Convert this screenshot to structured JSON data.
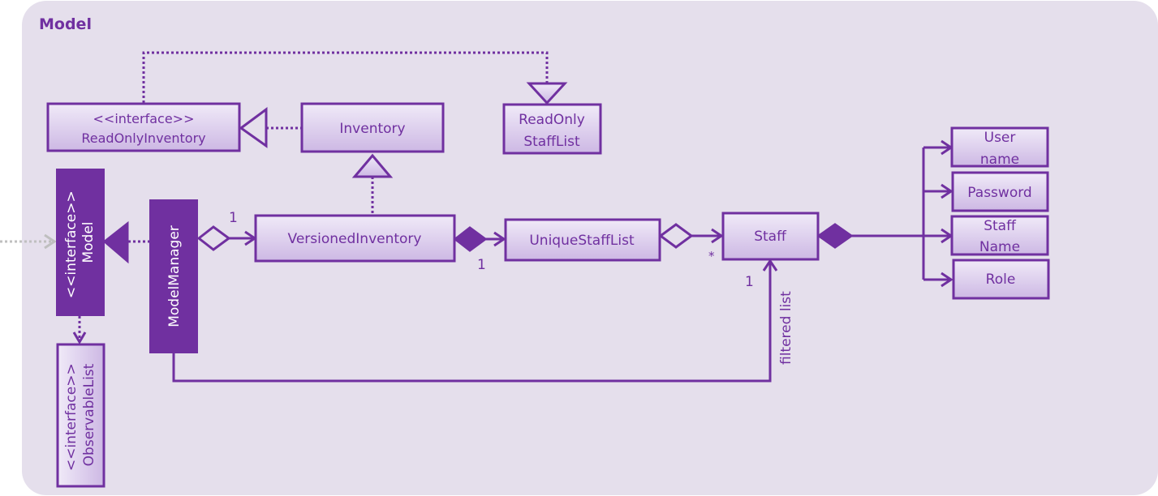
{
  "package": {
    "title": "Model"
  },
  "colors": {
    "primary": "#7030a0",
    "background": "#e5dfec",
    "box_fill_top": "#f0eaf8",
    "box_fill_bottom": "#cdb8e4",
    "external_arrow": "#bfbfbf"
  },
  "classes": {
    "read_only_inventory": {
      "stereotype": "<<interface>>",
      "name": "ReadOnlyInventory"
    },
    "inventory": {
      "name": "Inventory"
    },
    "read_only_staff_list": {
      "line1": "ReadOnly",
      "line2": "StaffList"
    },
    "model": {
      "stereotype": "<<interface>>",
      "name": "Model"
    },
    "model_manager": {
      "name": "ModelManager"
    },
    "observable_list": {
      "stereotype": "<<interface>>",
      "name": "ObservableList"
    },
    "versioned_inventory": {
      "name": "VersionedInventory"
    },
    "unique_staff_list": {
      "name": "UniqueStaffList"
    },
    "staff": {
      "name": "Staff"
    },
    "user_name": {
      "line1": "User",
      "line2": "name"
    },
    "password": {
      "name": "Password"
    },
    "staff_name": {
      "line1": "Staff",
      "line2": "Name"
    },
    "role": {
      "name": "Role"
    }
  },
  "multiplicities": {
    "manager_to_inventory": "1",
    "inventory_to_uniquelist": "1",
    "uniquelist_to_staff": "*",
    "manager_to_staff": "1"
  },
  "labels": {
    "filtered_list": "filtered list"
  }
}
